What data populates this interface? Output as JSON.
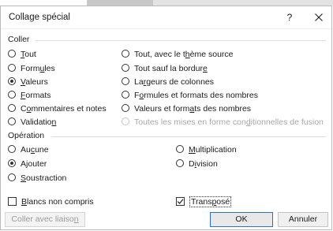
{
  "dialog": {
    "title": "Collage spécial",
    "help_label": "?"
  },
  "coller": {
    "label": "Coller",
    "left": [
      {
        "pre": "",
        "u": "T",
        "post": "out",
        "checked": false
      },
      {
        "pre": "Form",
        "u": "u",
        "post": "les",
        "checked": false
      },
      {
        "pre": "",
        "u": "V",
        "post": "aleurs",
        "checked": true
      },
      {
        "pre": "",
        "u": "F",
        "post": "ormats",
        "checked": false
      },
      {
        "pre": "C",
        "u": "o",
        "post": "mmentaires et notes",
        "checked": false
      },
      {
        "pre": "Validatio",
        "u": "n",
        "post": "",
        "checked": false
      }
    ],
    "right": [
      {
        "pre": "Tout, avec le t",
        "u": "h",
        "post": "ème source",
        "checked": false,
        "disabled": false
      },
      {
        "pre": "Tout sauf la bordur",
        "u": "e",
        "post": "",
        "checked": false,
        "disabled": false
      },
      {
        "pre": "La",
        "u": "r",
        "post": "geurs de colonnes",
        "checked": false,
        "disabled": false
      },
      {
        "pre": "F",
        "u": "o",
        "post": "rmules et formats des nombres",
        "checked": false,
        "disabled": false
      },
      {
        "pre": "Valeurs et form",
        "u": "a",
        "post": "ts des nombres",
        "checked": false,
        "disabled": false
      },
      {
        "pre": "Toutes les mises en forme con",
        "u": "d",
        "post": "itionnelles de fusion",
        "checked": false,
        "disabled": true
      }
    ]
  },
  "operation": {
    "label": "Opération",
    "left": [
      {
        "pre": "Au",
        "u": "c",
        "post": "une",
        "checked": false
      },
      {
        "pre": "A",
        "u": "j",
        "post": "outer",
        "checked": true
      },
      {
        "pre": "",
        "u": "S",
        "post": "oustraction",
        "checked": false
      }
    ],
    "right": [
      {
        "pre": "",
        "u": "M",
        "post": "ultiplication",
        "checked": false
      },
      {
        "pre": "D",
        "u": "i",
        "post": "vision",
        "checked": false
      }
    ]
  },
  "checks": {
    "skip_blanks": {
      "pre": "",
      "u": "B",
      "post": "lancs non compris",
      "checked": false
    },
    "transpose": {
      "pre": "Trans",
      "u": "p",
      "post": "osé",
      "checked": true
    }
  },
  "buttons": {
    "paste_link": {
      "pre": "Coller avec liaiso",
      "u": "n",
      "post": ""
    },
    "ok": "OK",
    "cancel": "Annuler"
  }
}
